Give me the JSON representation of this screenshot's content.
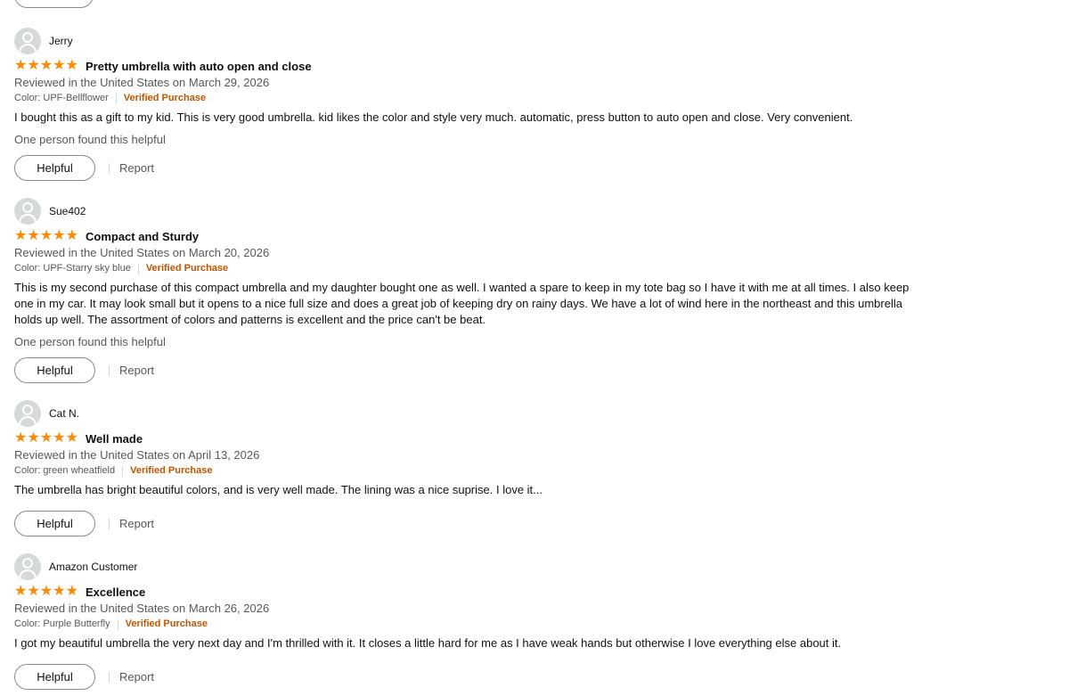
{
  "reviews": [
    {
      "profile_name": "Jerry",
      "rating": 5,
      "title": "Pretty umbrella with auto open and close",
      "date": "Reviewed in the United States on March 29, 2026",
      "format": "Color: UPF-Bellflower",
      "verified": "Verified Purchase",
      "body": "I bought this as a gift to my kid. This is very good umbrella. kid likes the color and style very much. automatic, press button to auto open and close. Very convenient.",
      "helpful_count": "One person found this helpful",
      "helpful_label": "Helpful",
      "report_label": "Report"
    },
    {
      "profile_name": "Sue402",
      "rating": 5,
      "title": "Compact and Sturdy",
      "date": "Reviewed in the United States on March 20, 2026",
      "format": "Color: UPF-Starry sky blue",
      "verified": "Verified Purchase",
      "body": "This is my second purchase of this compact umbrella and my daughter bought one as well. I wanted a spare to keep in my tote bag so I have it with me at all times. I also keep one in my car. It may look small but it opens to a nice full size and does a great job of keeping dry on rainy days. We have a lot of wind here in the northeast and this umbrella holds up well. The assortment of colors and patterns is excellent and the price can't be beat.",
      "helpful_count": "One person found this helpful",
      "helpful_label": "Helpful",
      "report_label": "Report"
    },
    {
      "profile_name": "Cat N.",
      "rating": 5,
      "title": "Well made",
      "date": "Reviewed in the United States on April 13, 2026",
      "format": "Color: green wheatfield",
      "verified": "Verified Purchase",
      "body": "The umbrella has bright beautiful colors, and is very well made. The lining was a nice suprise. I love it...",
      "helpful_label": "Helpful",
      "report_label": "Report"
    },
    {
      "profile_name": "Amazon Customer",
      "rating": 5,
      "title": "Excellence",
      "date": "Reviewed in the United States on March 26, 2026",
      "format": "Color: Purple Butterfly",
      "verified": "Verified Purchase",
      "body": "I got my beautiful umbrella the very next day and I'm thrilled with it. It closes a little hard for me as I have weak hands but otherwise I love everything else about it.",
      "helpful_label": "Helpful",
      "report_label": "Report"
    }
  ],
  "colors": {
    "star": "#ff8a00",
    "verified": "#c45500",
    "secondary_text": "#565959"
  }
}
